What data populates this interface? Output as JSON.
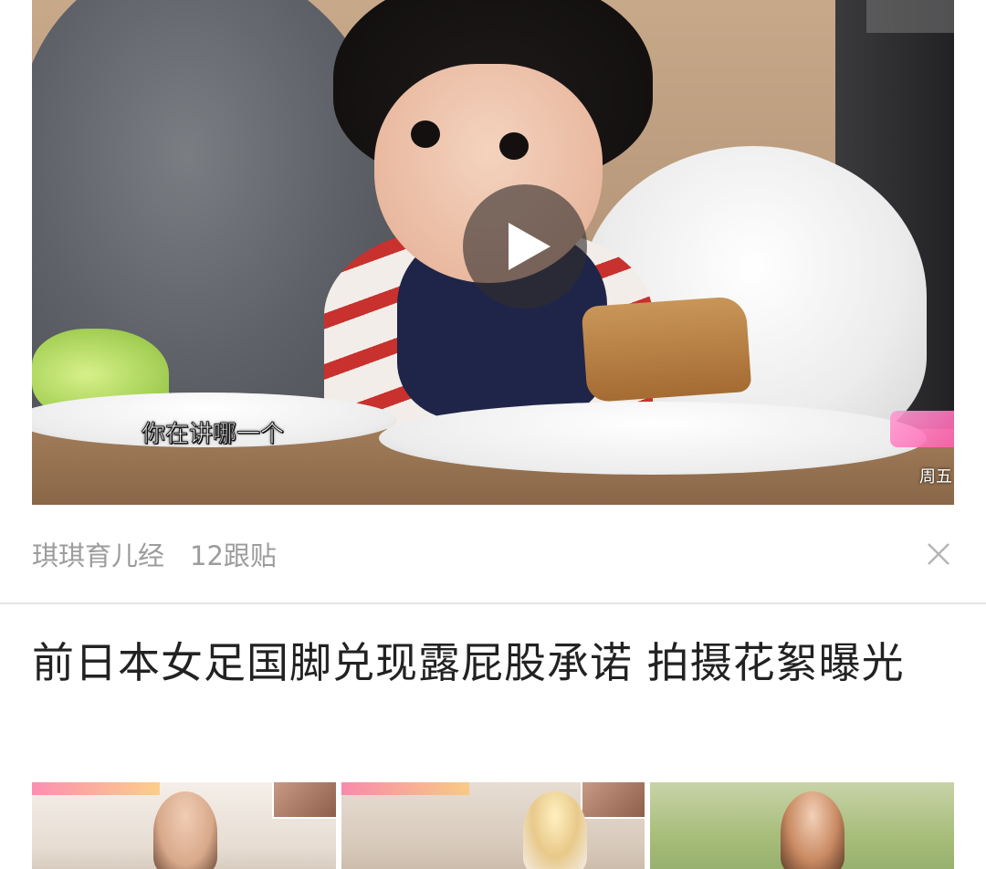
{
  "video_card": {
    "subtitle": "你在讲哪一个",
    "channel_logo_text": "周五",
    "source": "琪琪育儿经",
    "comments": "12跟贴"
  },
  "article": {
    "title": "前日本女足国脚兑现露屁股承诺 拍摄花絮曝光"
  },
  "icons": {
    "play": "play-icon",
    "close": "close-icon"
  },
  "colors": {
    "meta_text": "#9c9c9c",
    "title_text": "#222222",
    "divider": "#e4e4e4",
    "play_overlay": "rgba(50,45,45,0.62)"
  }
}
